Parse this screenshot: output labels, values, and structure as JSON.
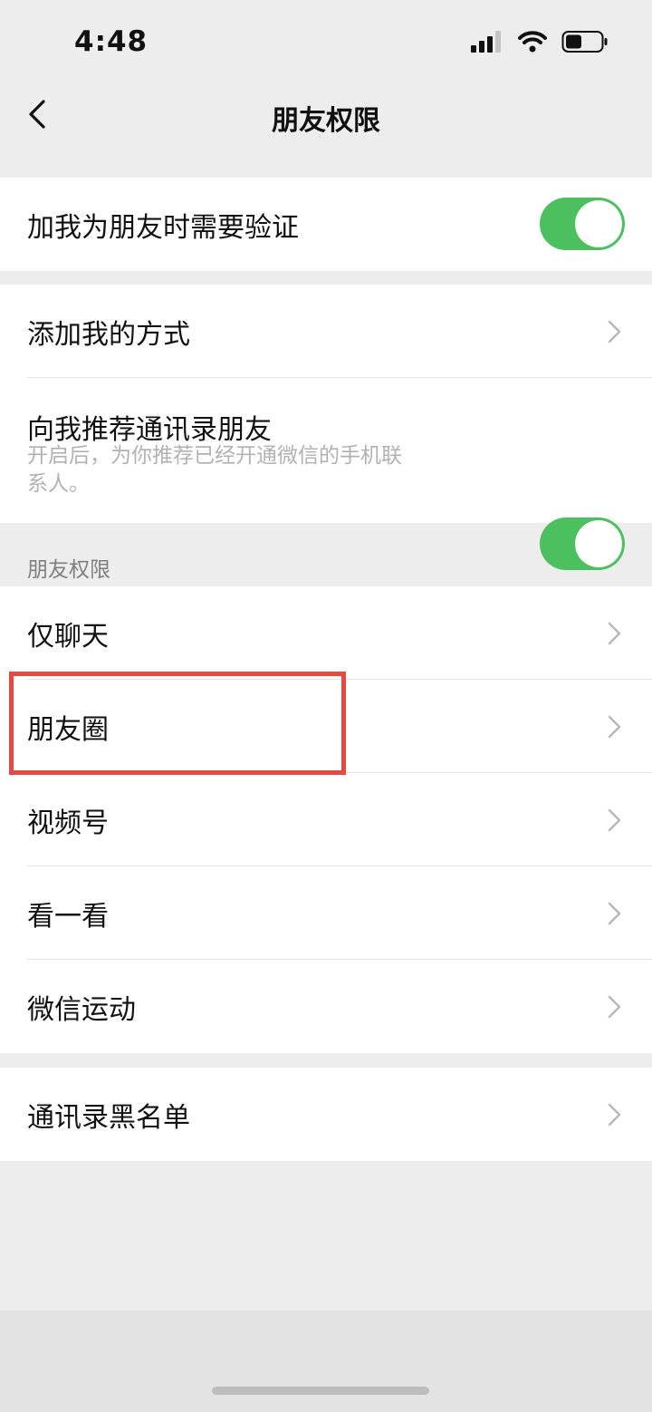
{
  "status_bar": {
    "time": "4:48"
  },
  "nav": {
    "title": "朋友权限"
  },
  "verify_toggle": {
    "label": "加我为朋友时需要验证",
    "on": true
  },
  "add_methods": {
    "label": "添加我的方式"
  },
  "recommend": {
    "label": "向我推荐通讯录朋友",
    "sublabel": "开启后，为你推荐已经开通微信的手机联系人。",
    "on": true
  },
  "permissions_section": {
    "header": "朋友权限",
    "items": [
      {
        "label": "仅聊天"
      },
      {
        "label": "朋友圈"
      },
      {
        "label": "视频号"
      },
      {
        "label": "看一看"
      },
      {
        "label": "微信运动"
      }
    ]
  },
  "blacklist": {
    "label": "通讯录黑名单"
  },
  "colors": {
    "toggle_on": "#4cc05f",
    "highlight": "#e5493f",
    "background": "#ededed"
  }
}
